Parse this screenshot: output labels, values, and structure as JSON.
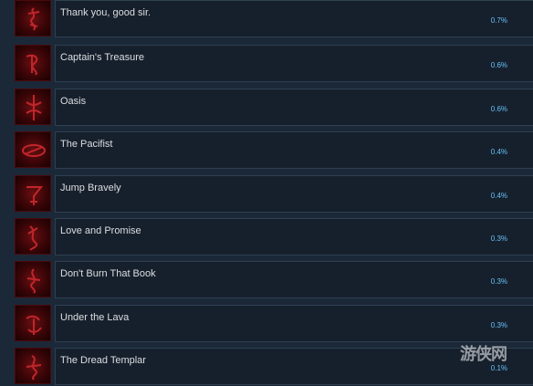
{
  "achievements": [
    {
      "name": "Thank you, good sir.",
      "percent": "0.7%",
      "icon": "red-rune-icon"
    },
    {
      "name": "Captain's Treasure",
      "percent": "0.6%",
      "icon": "red-rune-icon"
    },
    {
      "name": "Oasis",
      "percent": "0.6%",
      "icon": "red-rune-icon"
    },
    {
      "name": "The Pacifist",
      "percent": "0.4%",
      "icon": "red-rune-icon"
    },
    {
      "name": "Jump Bravely",
      "percent": "0.4%",
      "icon": "red-rune-icon"
    },
    {
      "name": "Love and Promise",
      "percent": "0.3%",
      "icon": "red-rune-icon"
    },
    {
      "name": "Don't Burn That Book",
      "percent": "0.3%",
      "icon": "red-rune-icon"
    },
    {
      "name": "Under the Lava",
      "percent": "0.3%",
      "icon": "red-rune-icon"
    },
    {
      "name": "The Dread Templar",
      "percent": "0.1%",
      "icon": "red-rune-icon"
    }
  ],
  "colors": {
    "background": "#1b2838",
    "row_background": "#16202d",
    "row_border": "#2f4050",
    "name_text": "#dcdedf",
    "percent_text": "#66c0f4",
    "icon_red": "#6a0f12"
  },
  "watermark": {
    "text": "游侠网",
    "icon": "watermark-logo-icon"
  }
}
